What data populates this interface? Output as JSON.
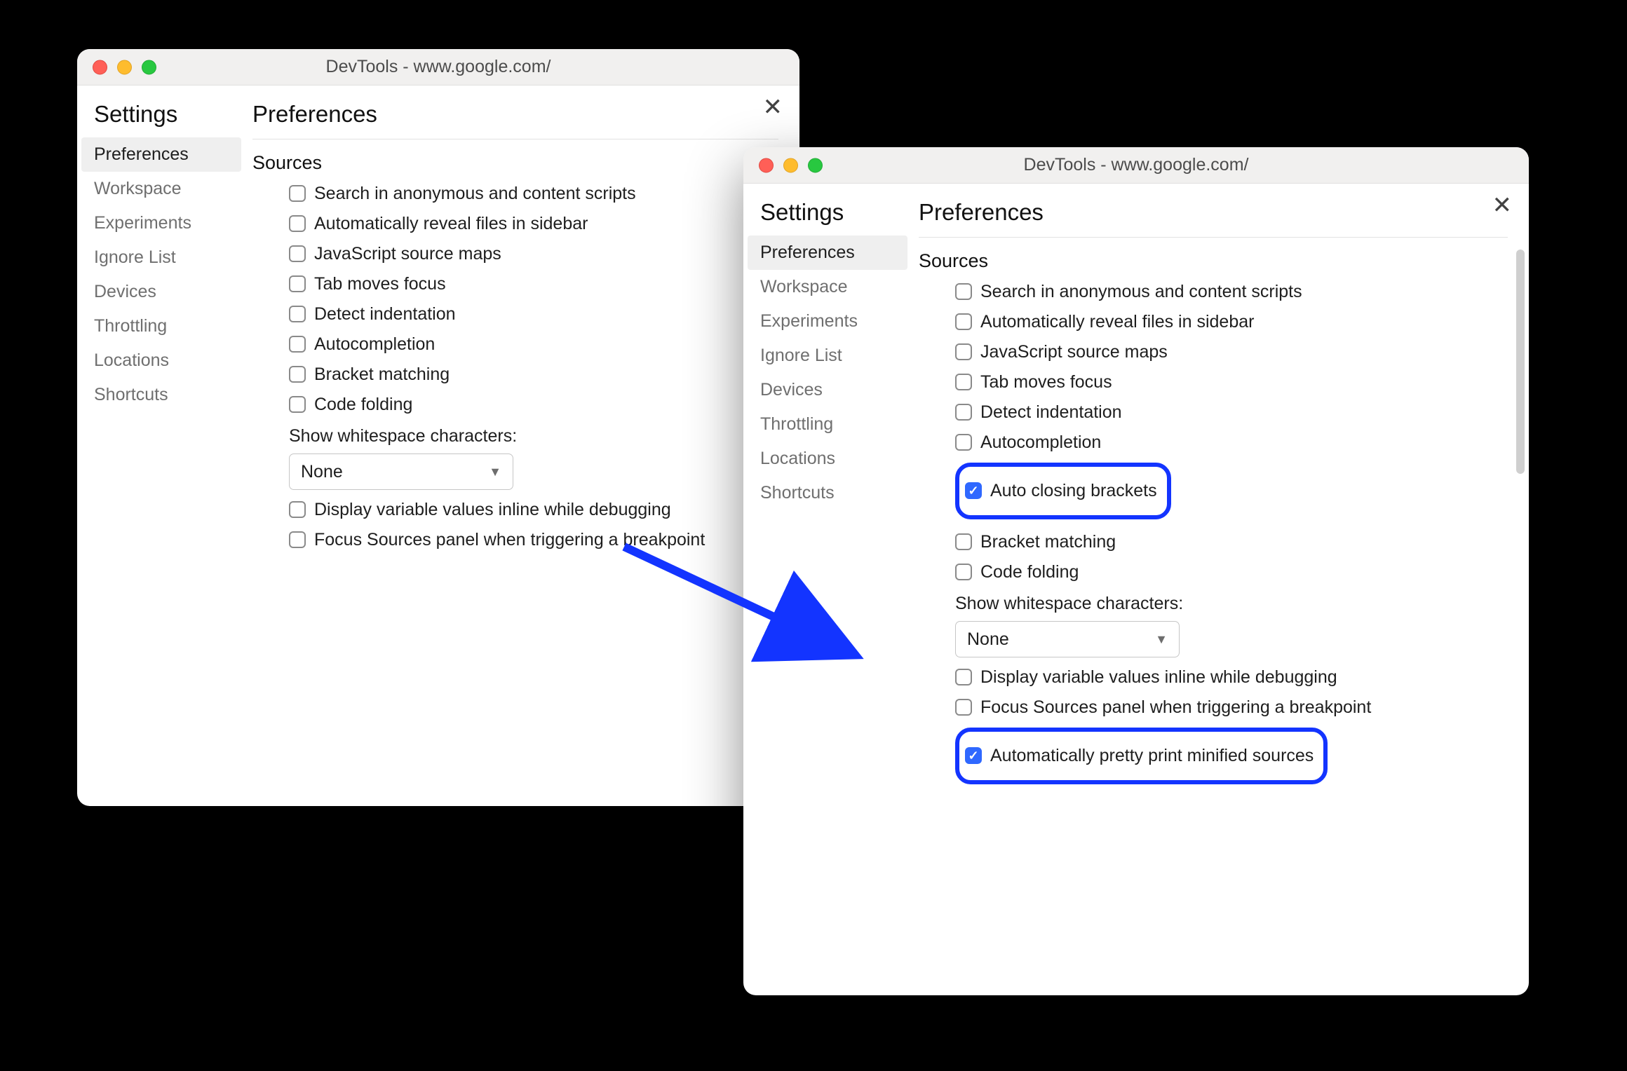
{
  "colors": {
    "highlight": "#1334ff",
    "checkbox_checked": "#2f68ff"
  },
  "windows": {
    "left": {
      "title": "DevTools - www.google.com/",
      "settings_heading": "Settings",
      "nav": [
        {
          "label": "Preferences",
          "selected": true
        },
        {
          "label": "Workspace",
          "selected": false
        },
        {
          "label": "Experiments",
          "selected": false
        },
        {
          "label": "Ignore List",
          "selected": false
        },
        {
          "label": "Devices",
          "selected": false
        },
        {
          "label": "Throttling",
          "selected": false
        },
        {
          "label": "Locations",
          "selected": false
        },
        {
          "label": "Shortcuts",
          "selected": false
        }
      ],
      "main_heading": "Preferences",
      "section": "Sources",
      "options": [
        {
          "label": "Search in anonymous and content scripts",
          "checked": false
        },
        {
          "label": "Automatically reveal files in sidebar",
          "checked": false
        },
        {
          "label": "JavaScript source maps",
          "checked": false
        },
        {
          "label": "Tab moves focus",
          "checked": false
        },
        {
          "label": "Detect indentation",
          "checked": false
        },
        {
          "label": "Autocompletion",
          "checked": false
        },
        {
          "label": "Bracket matching",
          "checked": false
        },
        {
          "label": "Code folding",
          "checked": false
        }
      ],
      "whitespace_label": "Show whitespace characters:",
      "whitespace_value": "None",
      "options2": [
        {
          "label": "Display variable values inline while debugging",
          "checked": false
        },
        {
          "label": "Focus Sources panel when triggering a breakpoint",
          "checked": false
        }
      ]
    },
    "right": {
      "title": "DevTools - www.google.com/",
      "settings_heading": "Settings",
      "nav": [
        {
          "label": "Preferences",
          "selected": true
        },
        {
          "label": "Workspace",
          "selected": false
        },
        {
          "label": "Experiments",
          "selected": false
        },
        {
          "label": "Ignore List",
          "selected": false
        },
        {
          "label": "Devices",
          "selected": false
        },
        {
          "label": "Throttling",
          "selected": false
        },
        {
          "label": "Locations",
          "selected": false
        },
        {
          "label": "Shortcuts",
          "selected": false
        }
      ],
      "main_heading": "Preferences",
      "section": "Sources",
      "options": [
        {
          "label": "Search in anonymous and content scripts",
          "checked": false
        },
        {
          "label": "Automatically reveal files in sidebar",
          "checked": false
        },
        {
          "label": "JavaScript source maps",
          "checked": false
        },
        {
          "label": "Tab moves focus",
          "checked": false
        },
        {
          "label": "Detect indentation",
          "checked": false
        },
        {
          "label": "Autocompletion",
          "checked": false
        },
        {
          "label": "Auto closing brackets",
          "checked": true,
          "highlight": true
        },
        {
          "label": "Bracket matching",
          "checked": false
        },
        {
          "label": "Code folding",
          "checked": false
        }
      ],
      "whitespace_label": "Show whitespace characters:",
      "whitespace_value": "None",
      "options2": [
        {
          "label": "Display variable values inline while debugging",
          "checked": false
        },
        {
          "label": "Focus Sources panel when triggering a breakpoint",
          "checked": false
        },
        {
          "label": "Automatically pretty print minified sources",
          "checked": true,
          "highlight": true
        }
      ]
    }
  }
}
